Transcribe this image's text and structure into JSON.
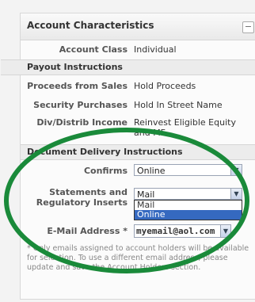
{
  "panel": {
    "title": "Account Characteristics",
    "collapse_symbol": "−"
  },
  "account": {
    "class_label": "Account Class",
    "class_value": "Individual"
  },
  "payout": {
    "section_title": "Payout Instructions",
    "proceeds_label": "Proceeds from Sales",
    "proceeds_value": "Hold Proceeds",
    "security_label": "Security Purchases",
    "security_value": "Hold In Street Name",
    "div_label": "Div/Distrib Income",
    "div_value_line1": "Reinvest Eligible Equity",
    "div_value_line2": "and MF"
  },
  "delivery": {
    "section_title": "Document Delivery Instructions",
    "confirms_label": "Confirms",
    "confirms_value": "Online",
    "statements_label_line1": "Statements and",
    "statements_label_line2": "Regulatory Inserts",
    "statements_value": "Mail",
    "statements_options": [
      "Mail",
      "Online"
    ],
    "statements_highlighted": "Online",
    "email_label": "E-Mail Address *",
    "email_value": "myemail@aol.com"
  },
  "note": "* Only emails assigned to account holders will be available for selection. To use a different email address, please update and save the Account Holders section.",
  "colors": {
    "highlight_ellipse": "#1a8a3a",
    "dropdown_selected": "#3569c0"
  }
}
